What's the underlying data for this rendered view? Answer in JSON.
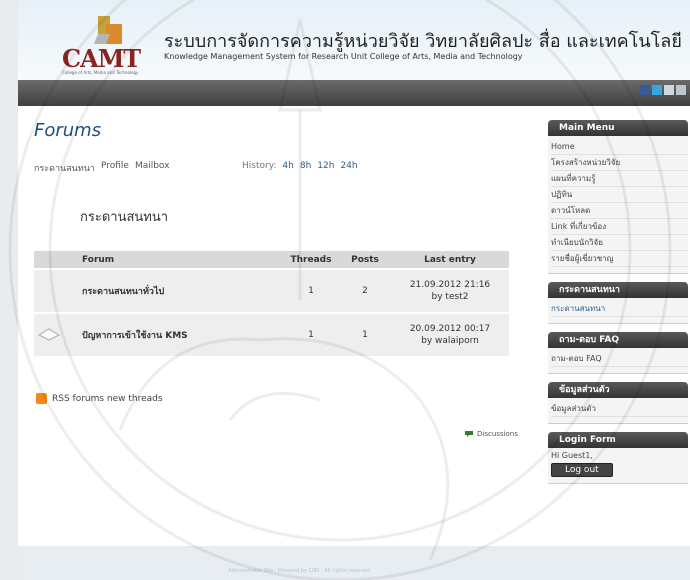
{
  "header": {
    "logo_text": "CAMT",
    "logo_sub": "College of Arts, Media and Technology",
    "title": "ระบบการจัดการความรู้หน่วยวิจัย วิทยาลัยศิลปะ สื่อ และเทคโนโลยี",
    "subtitle": "Knowledge Management System for Research Unit College of Arts, Media and Technology"
  },
  "page": {
    "heading": "Forums",
    "links": [
      "กระดานสนทนา",
      "Profile",
      "Mailbox"
    ],
    "history_label": "History:",
    "history": [
      "4h",
      "8h",
      "12h",
      "24h"
    ],
    "section_title": "กระดานสนทนา",
    "table": {
      "headers": {
        "forum": "Forum",
        "threads": "Threads",
        "posts": "Posts",
        "last": "Last entry"
      },
      "rows": [
        {
          "name": "กระดานสนทนาทั่วไป",
          "threads": "1",
          "posts": "2",
          "last_date": "21.09.2012 21:16",
          "last_by": "by test2"
        },
        {
          "name": "ปัญหาการเข้าใช้งาน KMS",
          "threads": "1",
          "posts": "1",
          "last_date": "20.09.2012 00:17",
          "last_by": "by walaiporn"
        }
      ]
    },
    "rss": "RSS forums new threads",
    "discussions": "Discussions"
  },
  "sidebar": {
    "main_menu": {
      "title": "Main Menu",
      "items": [
        "Home",
        "โครงสร้างหน่วยวิจัย",
        "แผนที่ความรู้",
        "ปฏิทิน",
        "ดาวน์โหลด",
        "Link ที่เกี่ยวข้อง",
        "ทำเนียบนักวิจัย",
        "รายชื่อผู้เชี่ยวชาญ"
      ]
    },
    "forum_box": {
      "title": "กระดานสนทนา",
      "item": "กระดานสนทนา"
    },
    "faq_box": {
      "title": "ถาม-ตอบ FAQ",
      "item": "ถาม-ตอบ FAQ"
    },
    "profile_box": {
      "title": "ข้อมูลส่วนตัว",
      "item": "ข้อมูลส่วนตัว"
    },
    "login_box": {
      "title": "Login Form",
      "greeting": "Hi Guest1,",
      "logout": "Log out"
    }
  },
  "footer": {
    "text": "Administrator Site · Powered by CMS · All rights reserved"
  },
  "colors": {
    "nav_dark": "#4a4a4a",
    "link_blue": "#2b5d8a",
    "logo_red": "#8a2323"
  }
}
